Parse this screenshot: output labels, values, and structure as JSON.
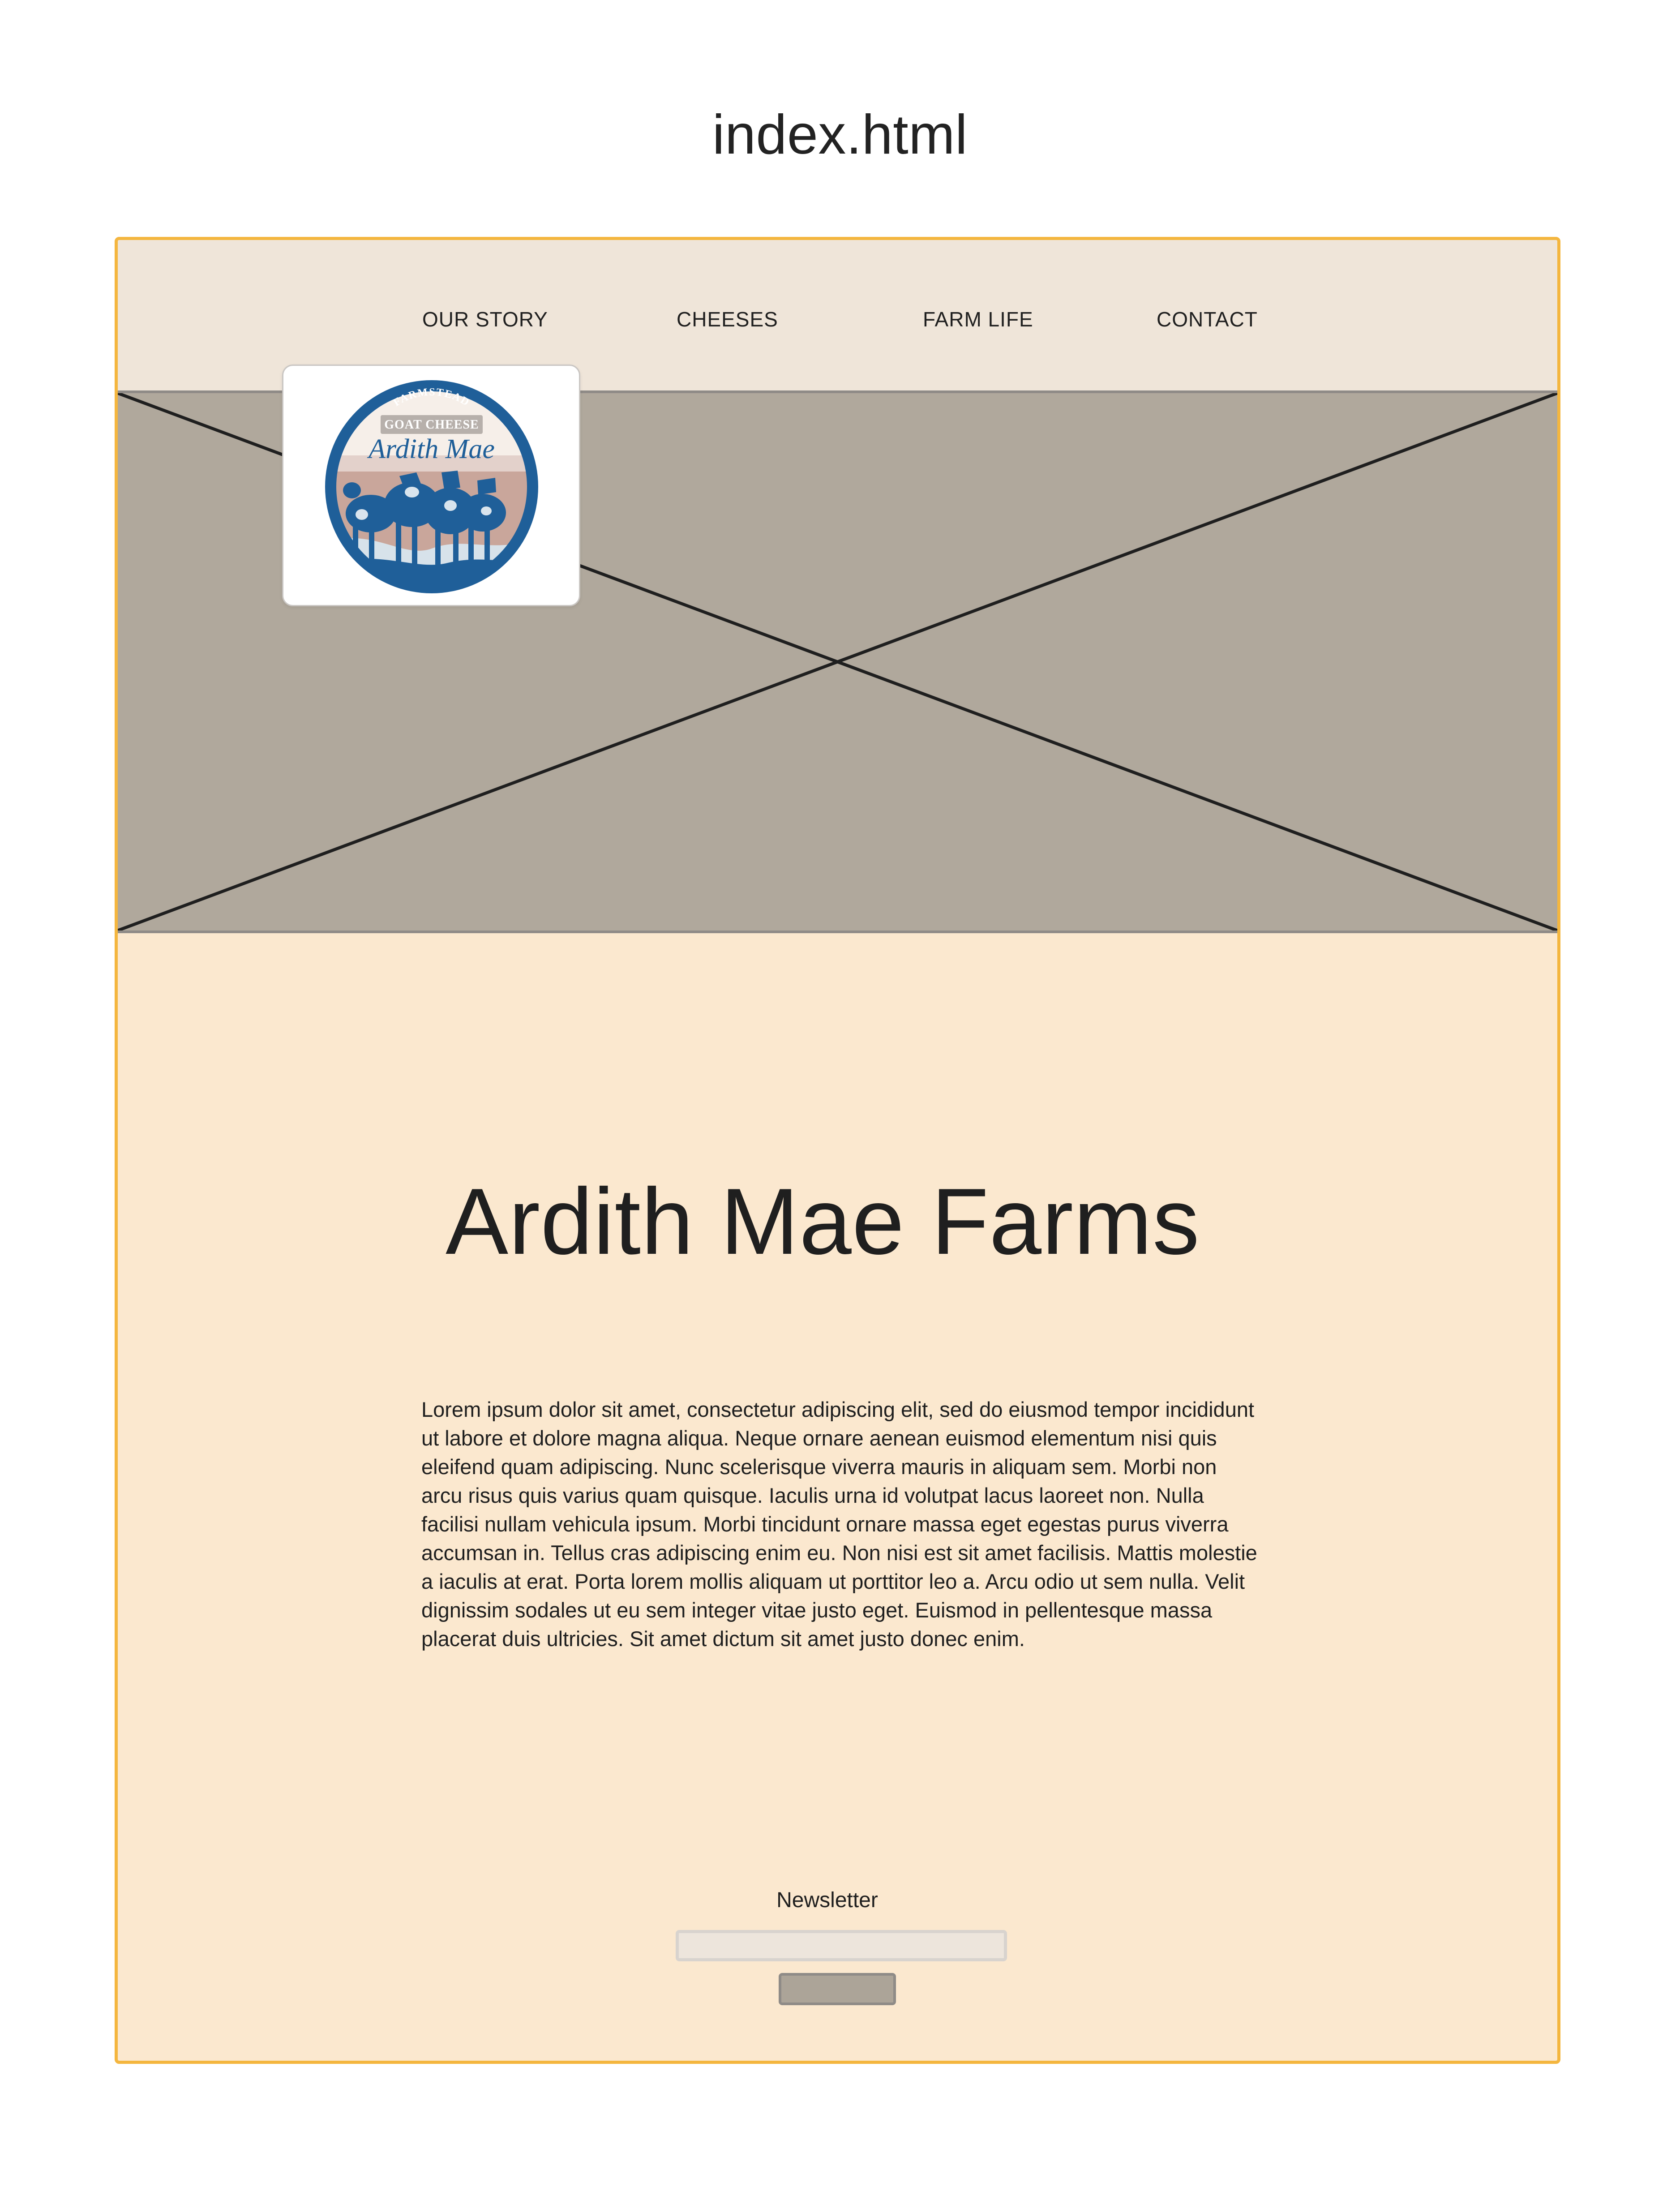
{
  "header": {
    "file_name": "index.html"
  },
  "nav": {
    "items": [
      {
        "label": "OUR STORY"
      },
      {
        "label": "CHEESES"
      },
      {
        "label": "FARM LIFE"
      },
      {
        "label": "CONTACT"
      }
    ]
  },
  "logo": {
    "top_text": "FARMSTEAD",
    "sub_text": "GOAT CHEESE",
    "script_text": "Ardith Mae"
  },
  "main": {
    "title": "Ardith Mae Farms",
    "body": "Lorem ipsum dolor sit amet, consectetur adipiscing elit, sed do eiusmod tempor incididunt ut labore et dolore magna aliqua. Neque ornare aenean euismod elementum nisi quis eleifend quam adipiscing. Nunc scelerisque viverra mauris in aliquam sem. Morbi non arcu risus quis varius quam quisque. Iaculis urna id volutpat lacus laoreet non. Nulla facilisi nullam vehicula ipsum. Morbi tincidunt ornare massa eget egestas purus viverra accumsan in. Tellus cras adipiscing enim eu. Non nisi est sit amet facilisis. Mattis molestie a iaculis at erat. Porta lorem mollis aliquam ut porttitor leo a. Arcu odio ut sem nulla. Velit dignissim sodales ut eu sem integer vitae justo eget. Euismod in pellentesque massa placerat duis ultricies. Sit amet dictum sit amet justo donec enim."
  },
  "newsletter": {
    "label": "Newsletter",
    "value": "",
    "placeholder": ""
  },
  "colors": {
    "frame_border": "#f4b63f",
    "nav_background": "#efe5d9",
    "hero_placeholder": "#b0a89c",
    "content_background": "#fbe8cf",
    "logo_blue": "#1f5f99"
  },
  "icons": {
    "hero_placeholder": "image-placeholder-icon",
    "logo": "goat-logo-icon"
  }
}
